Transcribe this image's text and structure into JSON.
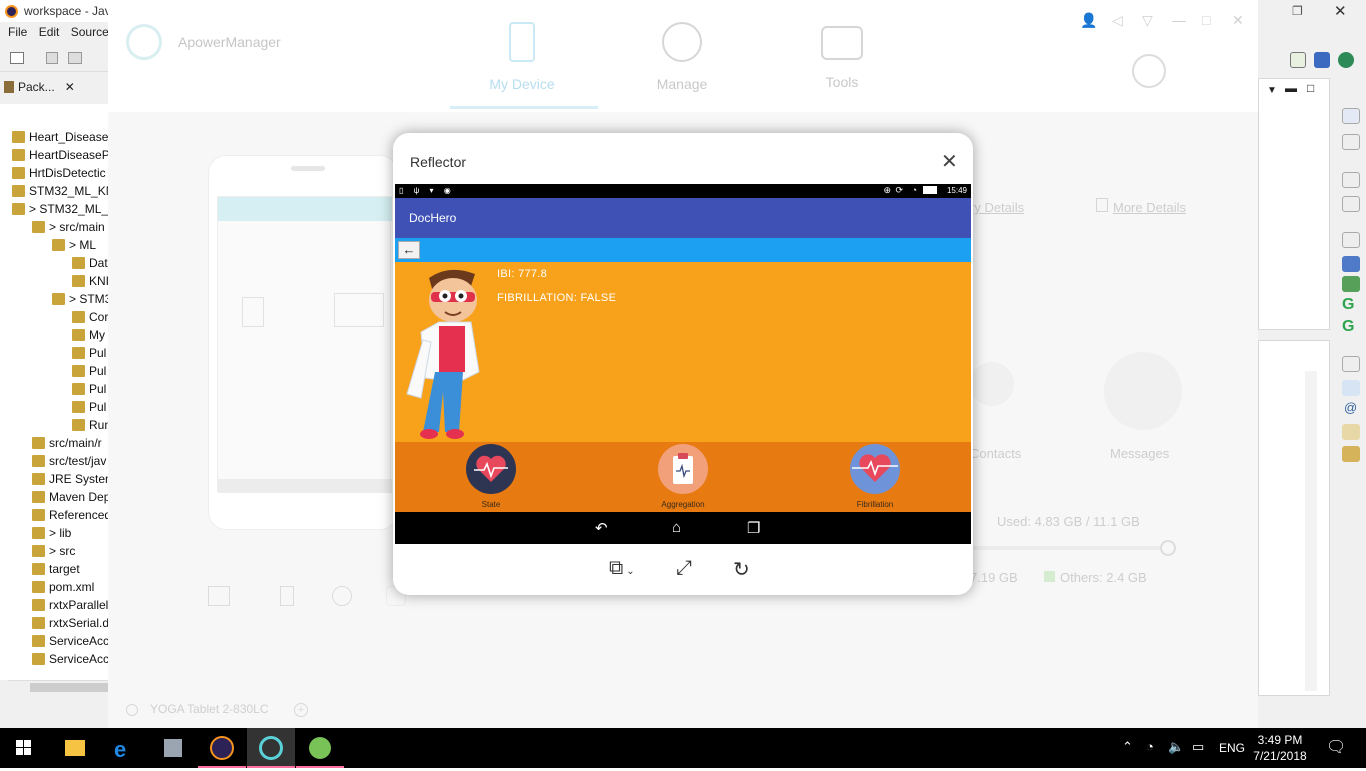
{
  "eclipse": {
    "title": "workspace - Java",
    "menu": [
      "File",
      "Edit",
      "Source"
    ],
    "view_tab": "Pack...",
    "tree": [
      {
        "label": "Heart_Disease_",
        "indent": 0
      },
      {
        "label": "HeartDiseaseP",
        "indent": 0
      },
      {
        "label": "HrtDisDetectic",
        "indent": 0
      },
      {
        "label": "STM32_ML_KN",
        "indent": 0
      },
      {
        "label": "> STM32_ML_",
        "indent": 0
      },
      {
        "label": "> src/main",
        "indent": 1
      },
      {
        "label": "> ML",
        "indent": 2
      },
      {
        "label": "Dat",
        "indent": 3
      },
      {
        "label": "KNI",
        "indent": 3
      },
      {
        "label": "> STM3",
        "indent": 2
      },
      {
        "label": "Cor",
        "indent": 3
      },
      {
        "label": "My",
        "indent": 3
      },
      {
        "label": "Pul",
        "indent": 3
      },
      {
        "label": "Pul",
        "indent": 3
      },
      {
        "label": "Pul",
        "indent": 3
      },
      {
        "label": "Pul",
        "indent": 3
      },
      {
        "label": "Run",
        "indent": 3
      },
      {
        "label": "src/main/r",
        "indent": 1
      },
      {
        "label": "src/test/jav",
        "indent": 1
      },
      {
        "label": "JRE System",
        "indent": 1
      },
      {
        "label": "Maven Dep",
        "indent": 1
      },
      {
        "label": "Referenced",
        "indent": 1
      },
      {
        "label": "> lib",
        "indent": 1
      },
      {
        "label": "> src",
        "indent": 1
      },
      {
        "label": "target",
        "indent": 1
      },
      {
        "label": "pom.xml",
        "indent": 1
      },
      {
        "label": "rxtxParallel",
        "indent": 1
      },
      {
        "label": "rxtxSerial.d",
        "indent": 1
      },
      {
        "label": "ServiceAcc",
        "indent": 1
      },
      {
        "label": "ServiceAcc",
        "indent": 1
      }
    ]
  },
  "apower": {
    "app_name": "ApowerManager",
    "tabs": [
      "My Device",
      "Manage",
      "Tools"
    ],
    "links": [
      "ry Details",
      "More Details"
    ],
    "tiles": [
      "Contacts",
      "Messages"
    ],
    "storage_used": "Used: 4.83 GB / 11.1 GB",
    "storage_part": "7.19 GB",
    "storage_others": "Others: 2.4 GB",
    "device_name": "YOGA Tablet 2-830LC"
  },
  "reflector": {
    "title": "Reflector",
    "status_time": "15:49",
    "app_title": "DocHero",
    "ibi_label": "IBI:",
    "ibi_value": "777.8",
    "fib_label": "FIBRILLATION:",
    "fib_value": "FALSE",
    "bottom_buttons": [
      "State",
      "Aggregation",
      "Fibrillation"
    ]
  },
  "taskbar": {
    "language": "ENG",
    "time": "3:49 PM",
    "date": "7/21/2018"
  },
  "colors": {
    "app_bar": "#3f51b5",
    "back_bar": "#1ca0f2",
    "content_bg": "#f8a21b",
    "bottom_bar": "#e87a12"
  }
}
